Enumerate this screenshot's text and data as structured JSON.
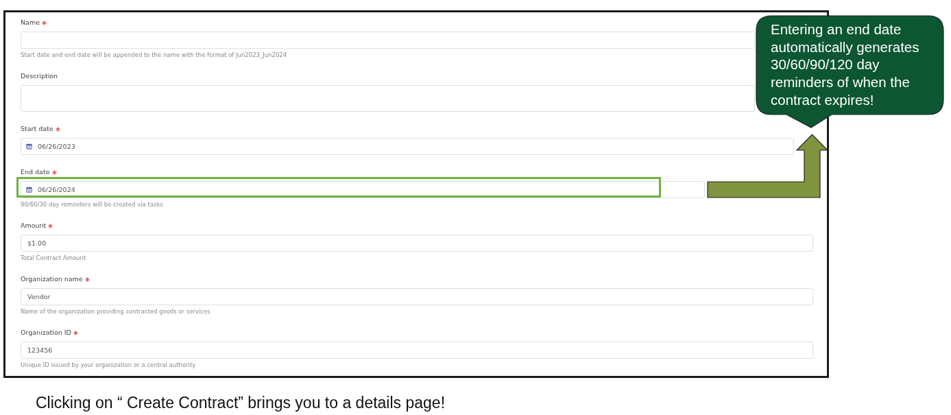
{
  "form": {
    "fields": [
      {
        "kind": "text",
        "label": "Name",
        "required": true,
        "hint": "Start date and end date will be appended to the name with the format of Jun2023_Jun2024",
        "highlighted": false
      },
      {
        "kind": "textarea",
        "label": "Description",
        "required": false,
        "highlighted": false
      },
      {
        "kind": "date",
        "label": "Start date",
        "required": true,
        "value": "06/26/2023",
        "highlighted": false
      },
      {
        "kind": "date",
        "label": "End date",
        "required": true,
        "value": "06/26/2024",
        "hint": "90/60/30 day reminders will be created via tasks",
        "highlighted": true
      },
      {
        "kind": "text",
        "label": "Amount",
        "required": true,
        "value": "$1.00",
        "hint": "Total Contract Amount",
        "highlighted": false
      },
      {
        "kind": "text",
        "label": "Organization name",
        "required": true,
        "value": "Vendor",
        "hint": "Name of the organization providing contracted goods or services",
        "highlighted": false
      },
      {
        "kind": "text",
        "label": "Organization ID",
        "required": true,
        "value": "123456",
        "hint": "Unique ID issued by your organization or a central authority",
        "highlighted": false
      }
    ]
  },
  "callout": {
    "text": "Entering an end date automatically generates 30/60/90/120 day reminders of when the contract expires!"
  },
  "caption": "Clicking on “ Create Contract” brings you to a details page!"
}
